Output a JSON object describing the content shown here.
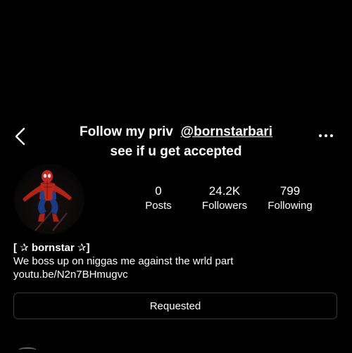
{
  "header": {
    "back_icon": "chevron-left-icon",
    "more_icon": "ellipsis-icon"
  },
  "overlay": {
    "line1_prefix": "Follow my priv  ",
    "line1_handle": "@bornstarbari",
    "line2": "see if u get accepted"
  },
  "profile": {
    "avatar_icon": "spiderman-avatar",
    "stats": {
      "posts_count": "0",
      "posts_label": "Posts",
      "followers_count": "24.2K",
      "followers_label": "Followers",
      "following_count": "799",
      "following_label": "Following"
    },
    "bio": {
      "name": "[ ✰ bornstar ✰]",
      "text": "We boss up on niggas me against the wrld part",
      "link": "youtu.be/N2n7BHmugvc"
    }
  },
  "actions": {
    "requested_label": "Requested"
  },
  "colors": {
    "background": "#000000",
    "text": "#ffffff",
    "button_border": "#3a3a3a"
  }
}
